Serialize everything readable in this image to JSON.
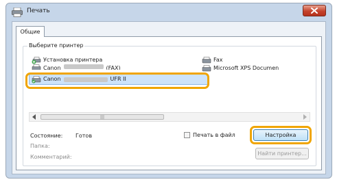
{
  "window": {
    "title": "Печать"
  },
  "tabs": [
    {
      "label": "Общие"
    }
  ],
  "printer_group": {
    "label": "Выберите принтер",
    "items": [
      {
        "label": "Установка принтера",
        "icon": "add-printer-icon"
      },
      {
        "label_prefix": "Canon",
        "label_suffix": "(FAX)",
        "icon": "fax-printer-icon"
      },
      {
        "label_prefix": "Canon",
        "label_suffix": "UFR II",
        "icon": "printer-icon",
        "selected": true
      },
      {
        "label": "Fax",
        "icon": "fax-icon"
      },
      {
        "label": "Microsoft XPS Documen",
        "icon": "xps-printer-icon"
      }
    ]
  },
  "scrollbar": {
    "thumb_grip": "|||"
  },
  "status": {
    "state_label": "Состояние:",
    "state_value": "Готов",
    "folder_label": "Папка:",
    "comment_label": "Комментарий:"
  },
  "print_to_file": {
    "label": "Печать в файл",
    "checked": false
  },
  "buttons": {
    "preferences": "Настройка",
    "find_printer": "Найти принтер..."
  },
  "colors": {
    "highlight": "#f0a500",
    "selection": "#cde3fa",
    "close_button": "#c5432c"
  }
}
